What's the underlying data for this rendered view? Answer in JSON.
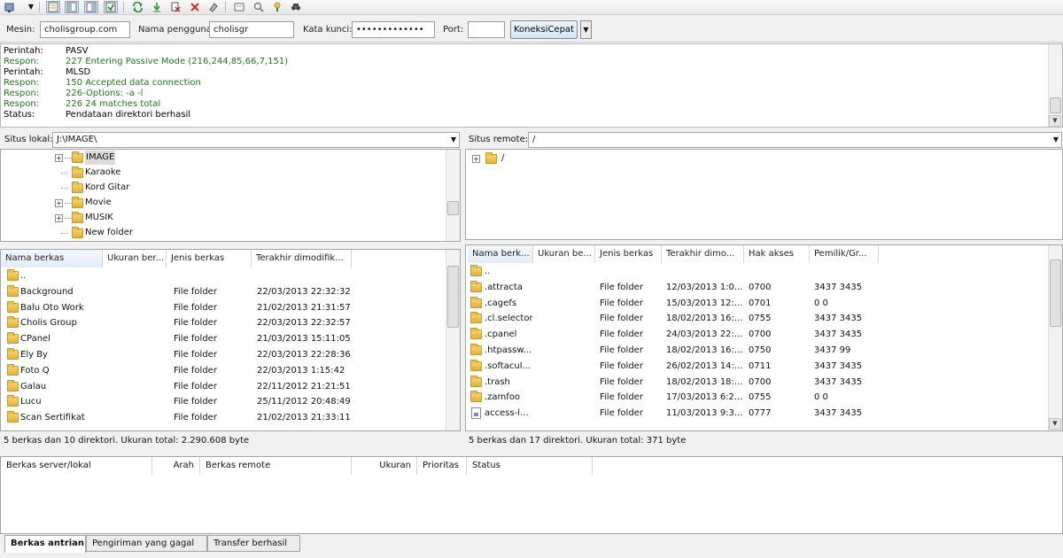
{
  "toolbar": {
    "buttons": [
      "site-manager",
      "toggle-log",
      "toggle-local-tree",
      "toggle-remote-tree",
      "toggle-queue",
      "refresh",
      "process-queue",
      "cancel",
      "disconnect",
      "reconnect",
      "directory-filters",
      "sync-browsing",
      "directory-comparison",
      "search"
    ]
  },
  "quickconnect": {
    "host_label": "Mesin:",
    "host_value": "cholisgroup.com",
    "user_label": "Nama pengguna:",
    "user_value": "cholisgr",
    "pass_label": "Kata kunci:",
    "pass_value": "•••••••••••••",
    "port_label": "Port:",
    "port_value": "",
    "connect_label": "KoneksiCepat",
    "dropdown_glyph": "▼"
  },
  "log": [
    {
      "type": "Perintah:",
      "text": "PASV",
      "color": "#000000"
    },
    {
      "type": "Respon:",
      "text": "227 Entering Passive Mode (216,244,85,66,7,151)",
      "color": "#1a7a1a"
    },
    {
      "type": "Perintah:",
      "text": "MLSD",
      "color": "#000000"
    },
    {
      "type": "Respon:",
      "text": "150 Accepted data connection",
      "color": "#1a7a1a"
    },
    {
      "type": "Respon:",
      "text": "226-Options: -a -l",
      "color": "#1a7a1a"
    },
    {
      "type": "Respon:",
      "text": "226 24 matches total",
      "color": "#1a7a1a"
    },
    {
      "type": "Status:",
      "text": "Pendataan direktori berhasil",
      "color": "#000000"
    }
  ],
  "local": {
    "site_label": "Situs lokal:",
    "path": "J:\\IMAGE\\",
    "tree": [
      {
        "name": "IMAGE",
        "expandable": true,
        "selected": true
      },
      {
        "name": "Karaoke",
        "expandable": false,
        "selected": false
      },
      {
        "name": "Kord Gitar",
        "expandable": false,
        "selected": false
      },
      {
        "name": "Movie",
        "expandable": true,
        "selected": false
      },
      {
        "name": "MUSIK",
        "expandable": true,
        "selected": false
      },
      {
        "name": "New folder",
        "expandable": false,
        "selected": false
      }
    ],
    "columns": [
      "Nama berkas",
      "Ukuran ber...",
      "Jenis berkas",
      "Terakhir dimodifik..."
    ],
    "rows": [
      {
        "name": "..",
        "size": "",
        "type": "",
        "modified": ""
      },
      {
        "name": "Background",
        "size": "",
        "type": "File folder",
        "modified": "22/03/2013 22:32:32"
      },
      {
        "name": "Balu Oto Work",
        "size": "",
        "type": "File folder",
        "modified": "21/02/2013 21:31:57"
      },
      {
        "name": "Cholis Group",
        "size": "",
        "type": "File folder",
        "modified": "22/03/2013 22:32:57"
      },
      {
        "name": "CPanel",
        "size": "",
        "type": "File folder",
        "modified": "21/03/2013 15:11:05"
      },
      {
        "name": "Ely By",
        "size": "",
        "type": "File folder",
        "modified": "22/03/2013 22:28:36"
      },
      {
        "name": "Foto Q",
        "size": "",
        "type": "File folder",
        "modified": "22/03/2013 1:15:42"
      },
      {
        "name": "Galau",
        "size": "",
        "type": "File folder",
        "modified": "22/11/2012 21:21:51"
      },
      {
        "name": "Lucu",
        "size": "",
        "type": "File folder",
        "modified": "25/11/2012 20:48:49"
      },
      {
        "name": "Scan Sertifikat",
        "size": "",
        "type": "File folder",
        "modified": "21/02/2013 21:33:11"
      }
    ],
    "status": "5 berkas dan 10 direktori. Ukuran total: 2.290.608 byte"
  },
  "remote": {
    "site_label": "Situs remote:",
    "path": "/",
    "tree": [
      {
        "name": "/",
        "expandable": true,
        "selected": false
      }
    ],
    "columns": [
      "Nama berk...",
      "Ukuran be...",
      "Jenis berkas",
      "Terakhir dimo...",
      "Hak akses",
      "Pemilik/Gr..."
    ],
    "rows": [
      {
        "name": "..",
        "size": "",
        "type": "",
        "modified": "",
        "perm": "",
        "owner": "",
        "kind": "folder"
      },
      {
        "name": ".attracta",
        "size": "",
        "type": "File folder",
        "modified": "12/03/2013 1:0...",
        "perm": "0700",
        "owner": "3437 3435",
        "kind": "folder"
      },
      {
        "name": ".cagefs",
        "size": "",
        "type": "File folder",
        "modified": "15/03/2013 12:...",
        "perm": "0701",
        "owner": "0 0",
        "kind": "folder"
      },
      {
        "name": ".cl.selector",
        "size": "",
        "type": "File folder",
        "modified": "18/02/2013 16:...",
        "perm": "0755",
        "owner": "3437 3435",
        "kind": "folder"
      },
      {
        "name": ".cpanel",
        "size": "",
        "type": "File folder",
        "modified": "24/03/2013 22:...",
        "perm": "0700",
        "owner": "3437 3435",
        "kind": "folder"
      },
      {
        "name": ".htpassw...",
        "size": "",
        "type": "File folder",
        "modified": "18/02/2013 16:...",
        "perm": "0750",
        "owner": "3437 99",
        "kind": "folder"
      },
      {
        "name": ".softacul...",
        "size": "",
        "type": "File folder",
        "modified": "26/02/2013 14:...",
        "perm": "0711",
        "owner": "3437 3435",
        "kind": "folder"
      },
      {
        "name": ".trash",
        "size": "",
        "type": "File folder",
        "modified": "18/02/2013 18:...",
        "perm": "0700",
        "owner": "3437 3435",
        "kind": "folder"
      },
      {
        "name": ".zamfoo",
        "size": "",
        "type": "File folder",
        "modified": "17/03/2013 6:2...",
        "perm": "0755",
        "owner": "0 0",
        "kind": "folder"
      },
      {
        "name": "access-l...",
        "size": "",
        "type": "File folder",
        "modified": "11/03/2013 9:3...",
        "perm": "0777",
        "owner": "3437 3435",
        "kind": "file"
      }
    ],
    "status": "5 berkas dan 17 direktori. Ukuran total: 371 byte"
  },
  "queue": {
    "columns": [
      "Berkas server/lokal",
      "Arah",
      "Berkas remote",
      "Ukuran",
      "Prioritas",
      "Status"
    ]
  },
  "tabs": [
    {
      "label": "Berkas antrian",
      "active": true
    },
    {
      "label": "Pengiriman yang gagal",
      "active": false
    },
    {
      "label": "Transfer berhasil",
      "active": false
    }
  ]
}
